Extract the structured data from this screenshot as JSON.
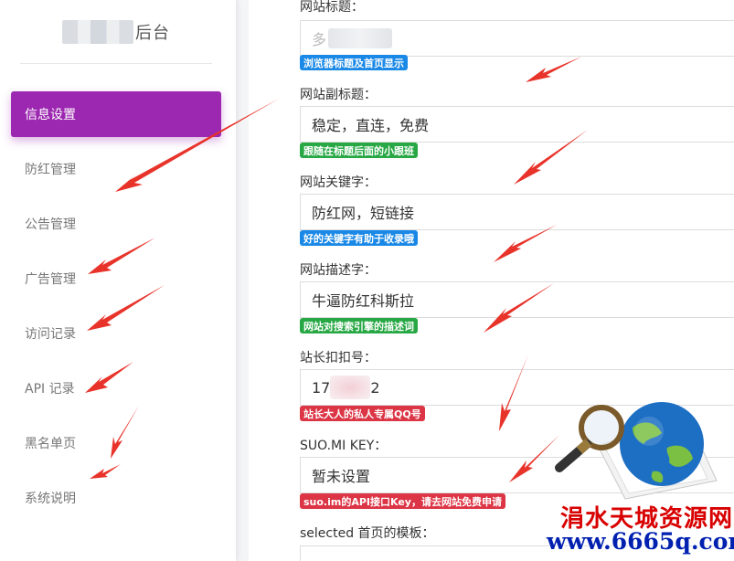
{
  "sidebar": {
    "brand_suffix": "后台",
    "items": [
      {
        "label": "信息设置",
        "active": true
      },
      {
        "label": "防红管理"
      },
      {
        "label": "公告管理"
      },
      {
        "label": "广告管理"
      },
      {
        "label": "访问记录"
      },
      {
        "label": "API 记录"
      },
      {
        "label": "黑名单页"
      },
      {
        "label": "系统说明"
      }
    ]
  },
  "form": {
    "site_title": {
      "label": "网站标题：",
      "value": "多",
      "hint": "浏览器标题及首页显示"
    },
    "site_subtitle": {
      "label": "网站副标题：",
      "value": "稳定，直连，免费",
      "hint": "跟随在标题后面的小跟班"
    },
    "keywords": {
      "label": "网站关键字：",
      "value": "防红网，短链接",
      "hint": "好的关键字有助于收录哦"
    },
    "description": {
      "label": "网站描述字：",
      "value": "牛逼防红科斯拉",
      "hint": "网站对搜索引擎的描述词"
    },
    "qq": {
      "label": "站长扣扣号：",
      "value_prefix": "17",
      "value_suffix": "2",
      "hint": "站长大人的私人专属QQ号"
    },
    "suomi_key": {
      "label": "SUO.MI KEY：",
      "value": "暂未设置",
      "hint": "suo.im的API接口Key，请去网站免费申请"
    },
    "template": {
      "label": "selected 首页的模板："
    }
  },
  "watermark": {
    "title": "涓水天城资源网",
    "url": "www.6665q.com"
  },
  "colors": {
    "accent": "#9c27b0",
    "badge_blue": "#1a88e6",
    "badge_green": "#27a844",
    "badge_red": "#dc3545",
    "arrow": "#e8332a"
  }
}
